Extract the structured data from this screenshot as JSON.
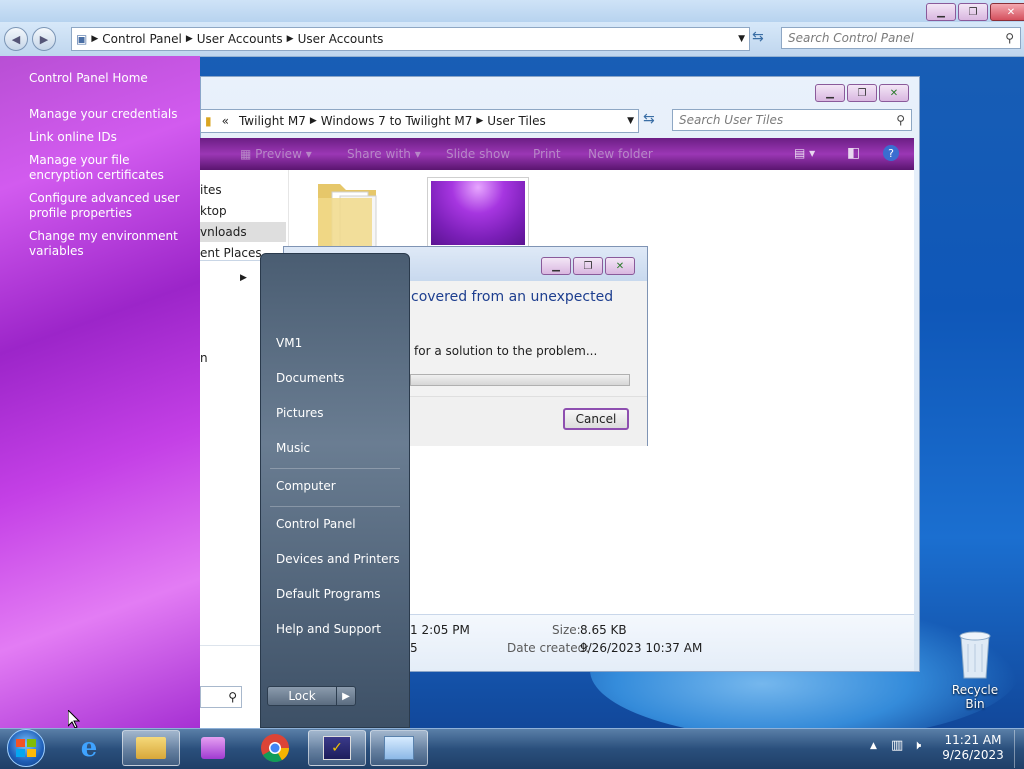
{
  "control_panel": {
    "breadcrumb": [
      "Control Panel",
      "User Accounts",
      "User Accounts"
    ],
    "search_placeholder": "Search Control Panel",
    "tasks": [
      "Control Panel Home",
      "Manage your credentials",
      "Link online IDs",
      "Manage your file encryption certificates",
      "Configure advanced user profile properties",
      "Change my environment variables"
    ]
  },
  "explorer": {
    "breadcrumb_prefix": "«",
    "breadcrumb": [
      "Twilight M7",
      "Windows 7 to Twilight M7",
      "User Tiles"
    ],
    "search_placeholder": "Search User Tiles",
    "toolbar": [
      "Preview",
      "Share with",
      "Slide show",
      "Print",
      "New folder"
    ],
    "nav": [
      "ites",
      "ktop",
      "vnloads",
      "ent Places"
    ],
    "details": {
      "modified_partial": "1 2:05 PM",
      "partial2": "5",
      "size_label": "Size:",
      "size_value": "8.65 KB",
      "created_label": "Date created:",
      "created_value": "9/26/2023 10:37 AM"
    }
  },
  "dialog": {
    "heading": "covered from an unexpected",
    "status": "for a solution to the problem...",
    "cancel": "Cancel"
  },
  "start_menu": {
    "items": [
      "VM1",
      "Documents",
      "Pictures",
      "Music",
      "Computer",
      "Control Panel",
      "Devices and Printers",
      "Default Programs",
      "Help and Support"
    ],
    "lock": "Lock",
    "partial_left": "n"
  },
  "desktop": {
    "recycle_bin": "Recycle Bin"
  },
  "taskbar": {
    "time": "11:21 AM",
    "date": "9/26/2023"
  }
}
